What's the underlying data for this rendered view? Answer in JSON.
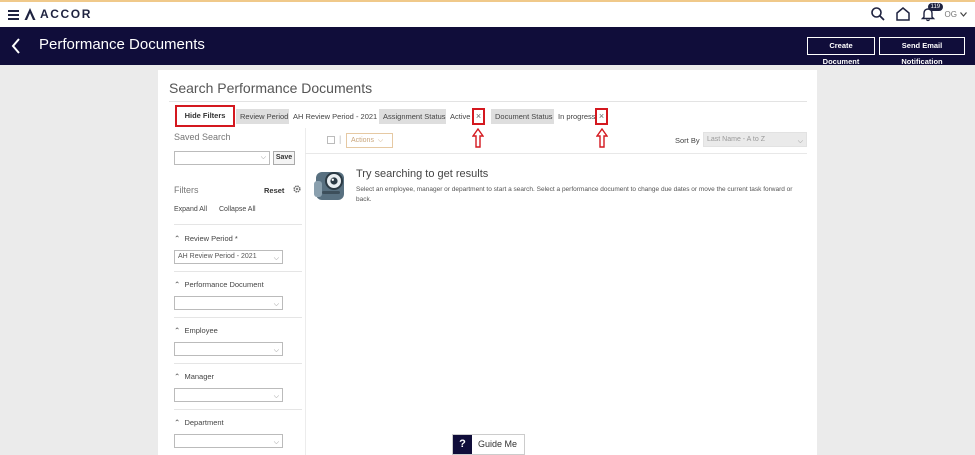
{
  "brand": {
    "name": "ACCOR"
  },
  "topbar": {
    "notification_count": "119",
    "user_initials": "OG"
  },
  "header": {
    "title": "Performance Documents",
    "create_document_label": "Create Document",
    "send_email_label": "Send Email Notification"
  },
  "search": {
    "title": "Search Performance Documents",
    "hide_filters_label": "Hide Filters",
    "chips": {
      "review_period_label": "Review Period",
      "review_period_value": "AH Review Period - 2021",
      "assignment_status_label": "Assignment Status",
      "assignment_status_value": "Active",
      "document_status_label": "Document Status",
      "document_status_value": "In progress",
      "close_glyph": "×"
    },
    "saved_search_label": "Saved Search",
    "save_label": "Save",
    "filters_label": "Filters",
    "reset_label": "Reset",
    "expand_all_label": "Expand All",
    "collapse_all_label": "Collapse All",
    "filter_groups": [
      {
        "label": "Review Period *",
        "value": "AH Review Period - 2021"
      },
      {
        "label": "Performance Document",
        "value": ""
      },
      {
        "label": "Employee",
        "value": ""
      },
      {
        "label": "Manager",
        "value": ""
      },
      {
        "label": "Department",
        "value": ""
      }
    ]
  },
  "results": {
    "actions_label": "Actions",
    "sort_by_label": "Sort By",
    "sort_value": "Last Name - A to Z",
    "empty_title": "Try searching to get results",
    "empty_text": "Select an employee, manager or department to start a search. Select a performance document to change due dates or move the current task forward or back."
  },
  "guide": {
    "q": "?",
    "label": "Guide Me"
  },
  "colors": {
    "header_bg": "#100d3a",
    "highlight": "#d4181f",
    "accent": "#e6c9a3"
  }
}
